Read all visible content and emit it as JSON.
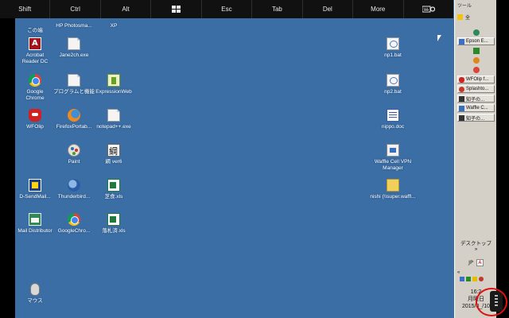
{
  "keybar": {
    "keys": [
      "Shift",
      "Ctrl",
      "Alt",
      "",
      "Esc",
      "Tab",
      "Del",
      "More",
      ""
    ],
    "icons": [
      "windows-key-icon",
      "keyboard-settings-icon"
    ]
  },
  "desktop": {
    "icons": [
      {
        "label": "この端",
        "icon": "file-icon"
      },
      {
        "label": "HP Photosma...",
        "icon": "file-icon"
      },
      {
        "label": "XP",
        "icon": "file-icon"
      },
      {
        "label": "Acrobat Reader DC",
        "icon": "acrobat-icon"
      },
      {
        "label": "Jane2ch.exe",
        "icon": "file-icon"
      },
      {
        "label": "Google Chrome",
        "icon": "chrome-icon"
      },
      {
        "label": "プログラムと機能",
        "icon": "file-icon"
      },
      {
        "label": "ExpressionWeb",
        "icon": "expression-web-icon"
      },
      {
        "label": "WFOlip",
        "icon": "wfolip-icon"
      },
      {
        "label": "FirefoxPortab...",
        "icon": "firefox-icon"
      },
      {
        "label": "notepad++.exe",
        "icon": "file-icon"
      },
      {
        "label": "Paint",
        "icon": "paint-icon"
      },
      {
        "label": "綱 ver6",
        "icon": "kanji-app-icon"
      },
      {
        "label": "D-SendMail...",
        "icon": "dsendmail-icon"
      },
      {
        "label": "Thunderbird...",
        "icon": "thunderbird-icon"
      },
      {
        "label": "芝食.xls",
        "icon": "excel-icon"
      },
      {
        "label": "Mail Distributor",
        "icon": "mail-icon"
      },
      {
        "label": "GoogleChro...",
        "icon": "chrome-icon"
      },
      {
        "label": "落札済.xls",
        "icon": "excel-icon"
      },
      {
        "label": "マウス",
        "icon": "mouse-icon"
      },
      {
        "label": "np1.bat",
        "icon": "bat-icon"
      },
      {
        "label": "np2.bat",
        "icon": "bat-icon"
      },
      {
        "label": "nippo.doc",
        "icon": "doc-icon"
      },
      {
        "label": "Waffle Cell VPN Manager",
        "icon": "vpn-icon"
      },
      {
        "label": "nishi (\\\\super.waffl...",
        "icon": "folder-icon"
      }
    ]
  },
  "taskbar": {
    "top_label": "ツール",
    "quicklaunch_label": "全",
    "buttons": [
      {
        "label": "Epson E...",
        "color": "#3b6fc4"
      },
      {
        "label": "",
        "color": "#2a8a2a"
      },
      {
        "label": "",
        "color": "#e0861a"
      },
      {
        "label": "",
        "color": "#db4437"
      },
      {
        "label": "WFOlip f...",
        "color": "#d02020"
      },
      {
        "label": "Splashto...",
        "color": "#c0392b"
      },
      {
        "label": "知子の...",
        "color": "#333333"
      },
      {
        "label": "Waffle C...",
        "color": "#3770b9"
      },
      {
        "label": "知子の...",
        "color": "#333333"
      }
    ],
    "desktop_label": "デスクトップ",
    "desktop_chevron": "»",
    "lang": "JP",
    "tray_chevron": "«",
    "clock_time": "16:2",
    "clock_day": "月曜日",
    "clock_date": "2015/0_/10"
  }
}
